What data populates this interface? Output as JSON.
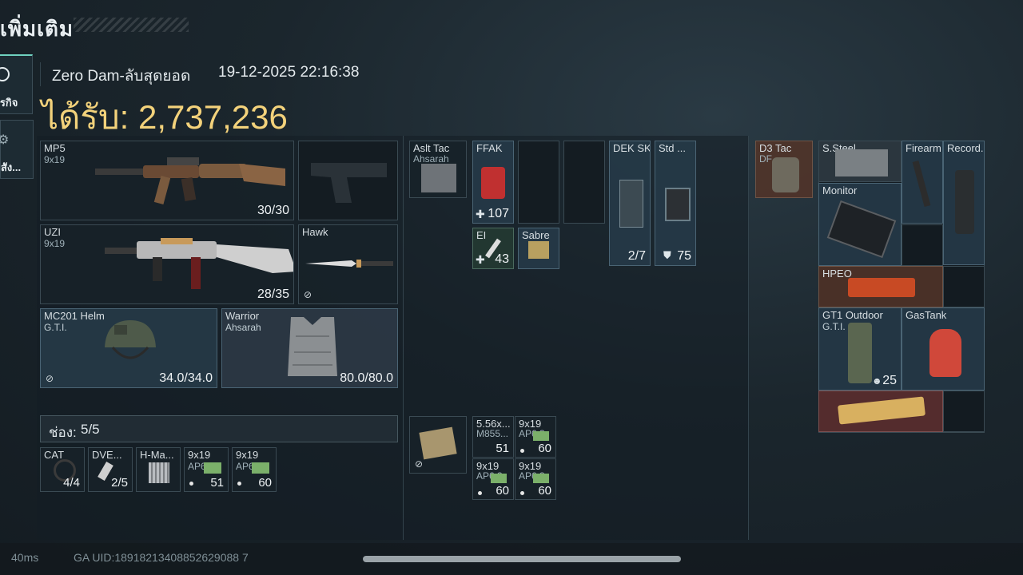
{
  "header": {
    "screen_title": "เพิ่มเติม",
    "map_name": "Zero Dam-ลับสุดยอด",
    "datetime": "19-12-2025 22:16:38",
    "reward_label": "ได้รับ:",
    "reward_value": "2,737,236"
  },
  "sidebar": {
    "tabs": [
      {
        "label": "ภารกิจ",
        "visible_label": "ภารกิจ",
        "icon": "target-icon",
        "active": true
      },
      {
        "label": "สัง...",
        "icon": "gear-icon",
        "active": false
      }
    ]
  },
  "loadout": {
    "primary": {
      "name": "MP5",
      "caliber": "9x19",
      "ammo": "30/30"
    },
    "secondary_empty": {
      "icon": "pistol-silhouette-icon"
    },
    "primary2": {
      "name": "UZI",
      "caliber": "9x19",
      "ammo": "28/35"
    },
    "melee": {
      "name": "Hawk"
    },
    "helmet": {
      "name": "MC201 Helm",
      "brand": "G.T.I.",
      "durability": "34.0/34.0"
    },
    "armor": {
      "name": "Warrior",
      "brand": "Ahsarah",
      "durability": "80.0/80.0"
    },
    "slots_label": "ช่อง:",
    "slots_value": "5/5",
    "pouch": [
      {
        "name": "CAT",
        "count": "4/4"
      },
      {
        "name": "DVE...",
        "count": "2/5"
      },
      {
        "name": "H-Ma..."
      },
      {
        "name": "9x19",
        "sub": "AP6.3",
        "count": "51"
      },
      {
        "name": "9x19",
        "sub": "AP6.3",
        "count": "60"
      }
    ]
  },
  "rig": {
    "name": "Aslt Tac",
    "brand": "Ahsarah",
    "items": [
      {
        "name": "FFAK",
        "count": "107"
      },
      {
        "name": "EI",
        "count": "43"
      },
      {
        "name": "Sabre"
      },
      {
        "name": "DEK SK",
        "count": "2/7"
      },
      {
        "name": "Std ...",
        "count": "75"
      }
    ],
    "ammo": [
      {
        "name": "5.56x...",
        "sub": "M855...",
        "count": "51"
      },
      {
        "name": "9x19",
        "sub": "AP6.3",
        "count": "60"
      },
      {
        "name": "9x19",
        "sub": "AP6.3",
        "count": "60"
      },
      {
        "name": "9x19",
        "sub": "AP6.3",
        "count": "60"
      }
    ]
  },
  "backpack": {
    "name": "D3 Tac",
    "brand": "DF",
    "items": [
      {
        "name": "S.Steel"
      },
      {
        "name": "Firearm"
      },
      {
        "name": "Record..."
      },
      {
        "name": "Monitor"
      },
      {
        "name": "HPEO"
      },
      {
        "name": "GT1 Outdoor",
        "brand": "G.T.I.",
        "count": "25"
      },
      {
        "name": "GasTank"
      },
      {
        "name": ""
      }
    ]
  },
  "footer": {
    "ping": "40ms",
    "uid": "GA UID:18918213408852629088 7"
  },
  "colors": {
    "reward": "#f3d27b",
    "accent": "#6fd2c0"
  }
}
